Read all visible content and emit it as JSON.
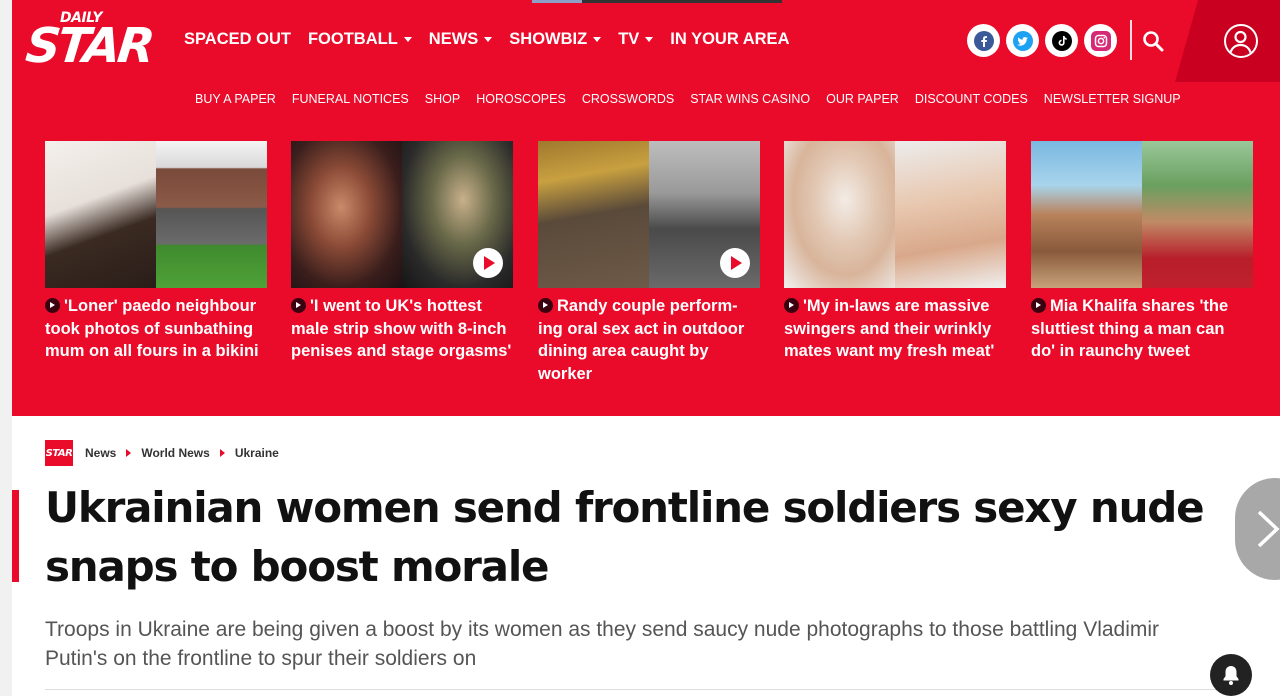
{
  "brand": {
    "daily": "DAILY",
    "star": "STAR",
    "mini": "STAR"
  },
  "main_nav": [
    {
      "label": "SPACED OUT",
      "dropdown": false
    },
    {
      "label": "FOOTBALL",
      "dropdown": true
    },
    {
      "label": "NEWS",
      "dropdown": true
    },
    {
      "label": "SHOWBIZ",
      "dropdown": true
    },
    {
      "label": "TV",
      "dropdown": true
    },
    {
      "label": "IN YOUR AREA",
      "dropdown": false
    }
  ],
  "socials": [
    "facebook-icon",
    "twitter-icon",
    "tiktok-icon",
    "instagram-icon"
  ],
  "sub_nav": [
    "BUY A PAPER",
    "FUNERAL NOTICES",
    "SHOP",
    "HOROSCOPES",
    "CROSSWORDS",
    "STAR WINS CASINO",
    "OUR PAPER",
    "DISCOUNT CODES",
    "NEWSLETTER SIGNUP"
  ],
  "promo": [
    {
      "headline": "'Loner' paedo neighbour took photos of sunbathing mum on all fours in a bikini",
      "video": false
    },
    {
      "headline": "'I went to UK's hottest male strip show with 8-inch penises and stage orgasms'",
      "video": true
    },
    {
      "headline": "Randy couple perform-ing oral sex act in outdoor dining area caught by worker",
      "video": true
    },
    {
      "headline": "'My in-laws are massive swingers and their wrinkly mates want my fresh meat'",
      "video": false
    },
    {
      "headline": "Mia Khalifa shares 'the sluttiest thing a man can do' in raunchy tweet",
      "video": false
    }
  ],
  "breadcrumb": [
    "News",
    "World News",
    "Ukraine"
  ],
  "article": {
    "title": "Ukrainian women send frontline soldiers sexy nude snaps to boost morale",
    "standfirst": "Troops in Ukraine are being given a boost by its women as they send saucy nude photographs to those battling Vladimir Putin's on the frontline to spur their soldiers on"
  },
  "colors": {
    "brand_red": "#ea0a2a",
    "dark_red": "#c9001f"
  }
}
